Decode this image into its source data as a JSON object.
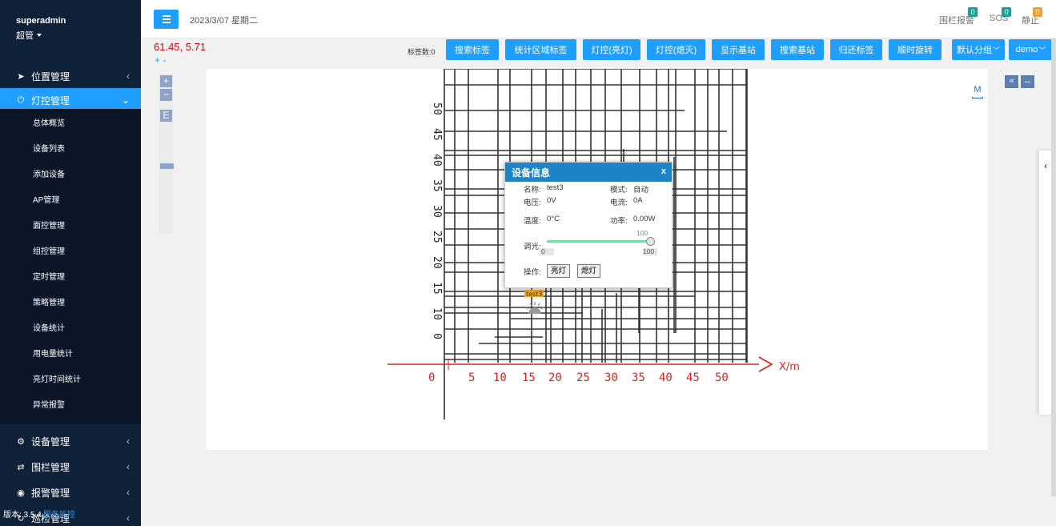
{
  "user": {
    "name": "superadmin",
    "role": "超管"
  },
  "nav": {
    "location": "位置管理",
    "lighting": "灯控管理",
    "lighting_sub": [
      "总体概览",
      "设备列表",
      "添加设备",
      "AP管理",
      "面控管理",
      "组控管理",
      "定时管理",
      "策略管理",
      "设备统计",
      "用电量统计",
      "亮灯时间统计",
      "异常报警"
    ],
    "device": "设备管理",
    "fence": "围栏管理",
    "alarm": "报警管理",
    "patrol": "巡检管理"
  },
  "version": {
    "label": "版本: 3.5.4",
    "link": "服务监控"
  },
  "topbar": {
    "date": "2023/3/07 星期二",
    "alerts": [
      {
        "label": "围栏报警",
        "count": "0",
        "color": "#1aa094"
      },
      {
        "label": "SOS",
        "count": "0",
        "color": "#1aa094"
      },
      {
        "label": "静止",
        "count": "0",
        "color": "#f0a030"
      }
    ]
  },
  "coords": "61.45, 5.71",
  "zoom_text": "+ -",
  "toolbar": {
    "tag_count": "标签数:0",
    "buttons": [
      "搜索标签",
      "统计区域标签",
      "灯控(亮灯)",
      "灯控(熄灭)",
      "显示基站",
      "搜索基站",
      "归还标签",
      "顺时旋转"
    ],
    "group_select": "默认分组",
    "map_select": "demo"
  },
  "map_controls": {
    "zoom_in": "+",
    "zoom_out": "−",
    "edit": "E",
    "measure": "M",
    "collapse": "«",
    "fit": "↔"
  },
  "map_grid": {
    "x_ticks": [
      "0",
      "5",
      "10",
      "15",
      "20",
      "25",
      "30",
      "35",
      "40",
      "45",
      "50"
    ],
    "y_ticks": [
      "0",
      "10",
      "15",
      "20",
      "25",
      "30",
      "35",
      "40",
      "45",
      "50"
    ],
    "x_label": "X/m",
    "marker_label": "test3"
  },
  "popup": {
    "title": "设备信息",
    "close": "x",
    "name_label": "名称:",
    "name": "test3",
    "mode_label": "模式:",
    "mode": "自动",
    "voltage_label": "电压:",
    "voltage": "0V",
    "current_label": "电流:",
    "current": "0A",
    "temp_label": "温度:",
    "temp": "0°C",
    "power_label": "功率:",
    "power": "0.00W",
    "dim_label": "调光:",
    "dim_value": "100",
    "dim_min": "0",
    "dim_max": "100",
    "dim_level": 1.0,
    "op_label": "操作:",
    "on_btn": "亮灯",
    "off_btn": "熄灯"
  }
}
